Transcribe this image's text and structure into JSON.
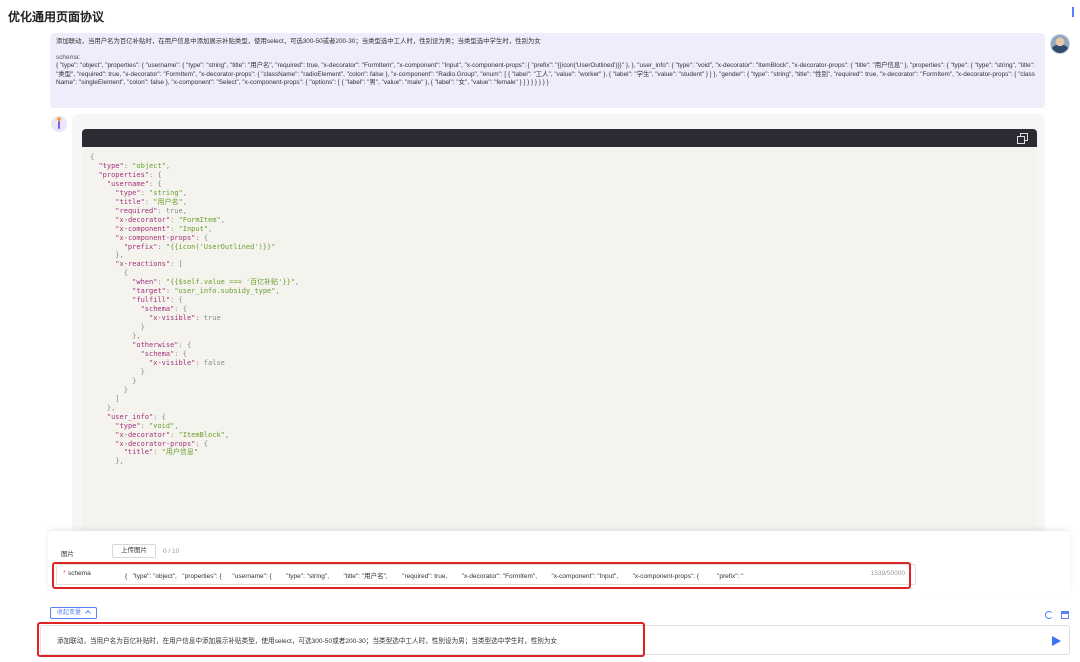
{
  "header": {
    "title": "优化通用页面协议"
  },
  "user_message": {
    "prompt": "添加联动，当用户名为百亿补贴时，在用户信息中添加展示补贴类型，使用select，可选300-50或者200-30；当类型选中工人时，性别设为男；当类型选中学生时，性别为女",
    "schema_label": "schema:",
    "schema_text": "{ \"type\": \"object\", \"properties\": { \"username\": { \"type\": \"string\", \"title\": \"用户名\", \"required\": true, \"x-decorator\": \"FormItem\", \"x-component\": \"Input\", \"x-component-props\": { \"prefix\": \"{{icon('UserOutlined')}}\" }, }, \"user_info\": { \"type\": \"void\", \"x-decorator\": \"ItemBlock\", \"x-decorator-props\": { \"title\": \"用户信息\" }, \"properties\": { \"type\": { \"type\": \"string\", \"title\": \"类型\", \"required\": true, \"x-decorator\": \"FormItem\", \"x-decorator-props\": { \"className\": \"radioElement\", \"colon\": false }, \"x-component\": \"Radio.Group\", \"enum\": [ { \"label\": \"工人\", \"value\": \"worker\" }, { \"label\": \"学生\", \"value\": \"student\" } ] }, \"gender\": { \"type\": \"string\", \"title\": \"性别\", \"required\": true, \"x-decorator\": \"FormItem\", \"x-decorator-props\": { \"className\": \"singleElement\", \"colon\": false }, \"x-component\": \"Select\", \"x-component-props\": { \"options\": [ { \"label\": \"男\", \"value\": \"male\" }, { \"label\": \"女\", \"value\": \"female\" } ] } } } } } }"
  },
  "code_lines": [
    [
      [
        "p",
        "{"
      ]
    ],
    [
      [
        "p",
        "  "
      ],
      [
        "k",
        "\"type\""
      ],
      [
        "p",
        ": "
      ],
      [
        "s",
        "\"object\""
      ],
      [
        "p",
        ","
      ]
    ],
    [
      [
        "p",
        "  "
      ],
      [
        "k",
        "\"properties\""
      ],
      [
        "p",
        ": {"
      ]
    ],
    [
      [
        "p",
        "    "
      ],
      [
        "k",
        "\"username\""
      ],
      [
        "p",
        ": {"
      ]
    ],
    [
      [
        "p",
        "      "
      ],
      [
        "k",
        "\"type\""
      ],
      [
        "p",
        ": "
      ],
      [
        "s",
        "\"string\""
      ],
      [
        "p",
        ","
      ]
    ],
    [
      [
        "p",
        "      "
      ],
      [
        "k",
        "\"title\""
      ],
      [
        "p",
        ": "
      ],
      [
        "s",
        "\"用户名\""
      ],
      [
        "p",
        ","
      ]
    ],
    [
      [
        "p",
        "      "
      ],
      [
        "k",
        "\"required\""
      ],
      [
        "p",
        ": true,"
      ]
    ],
    [
      [
        "p",
        "      "
      ],
      [
        "k",
        "\"x-decorator\""
      ],
      [
        "p",
        ": "
      ],
      [
        "s",
        "\"FormItem\""
      ],
      [
        "p",
        ","
      ]
    ],
    [
      [
        "p",
        "      "
      ],
      [
        "k",
        "\"x-component\""
      ],
      [
        "p",
        ": "
      ],
      [
        "s",
        "\"Input\""
      ],
      [
        "p",
        ","
      ]
    ],
    [
      [
        "p",
        "      "
      ],
      [
        "k",
        "\"x-component-props\""
      ],
      [
        "p",
        ": {"
      ]
    ],
    [
      [
        "p",
        "        "
      ],
      [
        "k",
        "\"prefix\""
      ],
      [
        "p",
        ": "
      ],
      [
        "s",
        "\"{{icon('UserOutlined')}}\""
      ]
    ],
    [
      [
        "p",
        "      },"
      ]
    ],
    [
      [
        "p",
        "      "
      ],
      [
        "k",
        "\"x-reactions\""
      ],
      [
        "p",
        ": ["
      ]
    ],
    [
      [
        "p",
        "        {"
      ]
    ],
    [
      [
        "p",
        "          "
      ],
      [
        "k",
        "\"when\""
      ],
      [
        "p",
        ": "
      ],
      [
        "s",
        "\"{{$self.value === '百亿补贴'}}\""
      ],
      [
        "p",
        ","
      ]
    ],
    [
      [
        "p",
        "          "
      ],
      [
        "k",
        "\"target\""
      ],
      [
        "p",
        ": "
      ],
      [
        "s",
        "\"user_info.subsidy_type\""
      ],
      [
        "p",
        ","
      ]
    ],
    [
      [
        "p",
        "          "
      ],
      [
        "k",
        "\"fulfill\""
      ],
      [
        "p",
        ": {"
      ]
    ],
    [
      [
        "p",
        "            "
      ],
      [
        "k",
        "\"schema\""
      ],
      [
        "p",
        ": {"
      ]
    ],
    [
      [
        "p",
        "              "
      ],
      [
        "k",
        "\"x-visible\""
      ],
      [
        "p",
        ": true"
      ]
    ],
    [
      [
        "p",
        "            }"
      ]
    ],
    [
      [
        "p",
        "          },"
      ]
    ],
    [
      [
        "p",
        "          "
      ],
      [
        "k",
        "\"otherwise\""
      ],
      [
        "p",
        ": {"
      ]
    ],
    [
      [
        "p",
        "            "
      ],
      [
        "k",
        "\"schema\""
      ],
      [
        "p",
        ": {"
      ]
    ],
    [
      [
        "p",
        "              "
      ],
      [
        "k",
        "\"x-visible\""
      ],
      [
        "p",
        ": false"
      ]
    ],
    [
      [
        "p",
        "            }"
      ]
    ],
    [
      [
        "p",
        "          }"
      ]
    ],
    [
      [
        "p",
        "        }"
      ]
    ],
    [
      [
        "p",
        "      ]"
      ]
    ],
    [
      [
        "p",
        "    },"
      ]
    ],
    [
      [
        "p",
        "    "
      ],
      [
        "k",
        "\"user_info\""
      ],
      [
        "p",
        ": {"
      ]
    ],
    [
      [
        "p",
        "      "
      ],
      [
        "k",
        "\"type\""
      ],
      [
        "p",
        ": "
      ],
      [
        "s",
        "\"void\""
      ],
      [
        "p",
        ","
      ]
    ],
    [
      [
        "p",
        "      "
      ],
      [
        "k",
        "\"x-decorator\""
      ],
      [
        "p",
        ": "
      ],
      [
        "s",
        "\"ItemBlock\""
      ],
      [
        "p",
        ","
      ]
    ],
    [
      [
        "p",
        "      "
      ],
      [
        "k",
        "\"x-decorator-props\""
      ],
      [
        "p",
        ": {"
      ]
    ],
    [
      [
        "p",
        "        "
      ],
      [
        "k",
        "\"title\""
      ],
      [
        "p",
        ": "
      ],
      [
        "s",
        "\"用户信息\""
      ]
    ],
    [
      [
        "p",
        "      },"
      ]
    ]
  ],
  "form": {
    "upload_label": "图片",
    "upload_button": "上传图片",
    "upload_count": "0 / 10",
    "schema_required_mark": "*",
    "schema_name": "schema",
    "schema_value": "{   \"type\": \"object\",   \"properties\": {      \"username\": {        \"type\": \"string\",        \"title\": \"用户名\",        \"required\": true,        \"x-decorator\": \"FormItem\",        \"x-component\": \"Input\",        \"x-component-props\": {          \"prefix\": \"",
    "schema_counter": "1539/50000"
  },
  "toolbar": {
    "collapse_label": "收起变量"
  },
  "chat_input": {
    "value": "添加联动，当用户名为百亿补贴时，在用户信息中添加展示补贴类型，使用select，可选300-50或者200-30；当类型选中工人时，性别设为男；当类型选中学生时，性别为女"
  }
}
